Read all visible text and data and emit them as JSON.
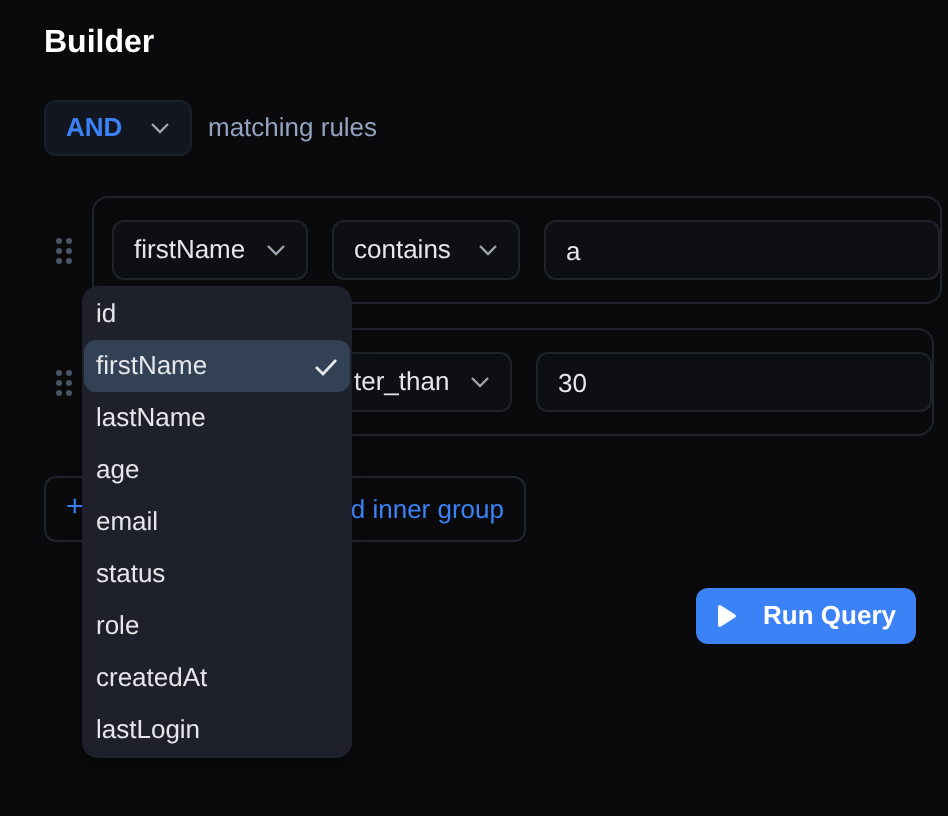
{
  "title": "Builder",
  "combinator": {
    "value": "AND",
    "label": "matching rules"
  },
  "rules": [
    {
      "field": "firstName",
      "operator": "contains",
      "value": "a"
    },
    {
      "operator": "ter_than",
      "value": "30"
    }
  ],
  "add_buttons": [
    {
      "label": "+"
    },
    {
      "label": "d inner group"
    }
  ],
  "field_menu": [
    {
      "label": "id",
      "selected": false
    },
    {
      "label": "firstName",
      "selected": true
    },
    {
      "label": "lastName",
      "selected": false
    },
    {
      "label": "age",
      "selected": false
    },
    {
      "label": "email",
      "selected": false
    },
    {
      "label": "status",
      "selected": false
    },
    {
      "label": "role",
      "selected": false
    },
    {
      "label": "createdAt",
      "selected": false
    },
    {
      "label": "lastLogin",
      "selected": false
    }
  ],
  "run_button": {
    "label": "Run Query"
  }
}
